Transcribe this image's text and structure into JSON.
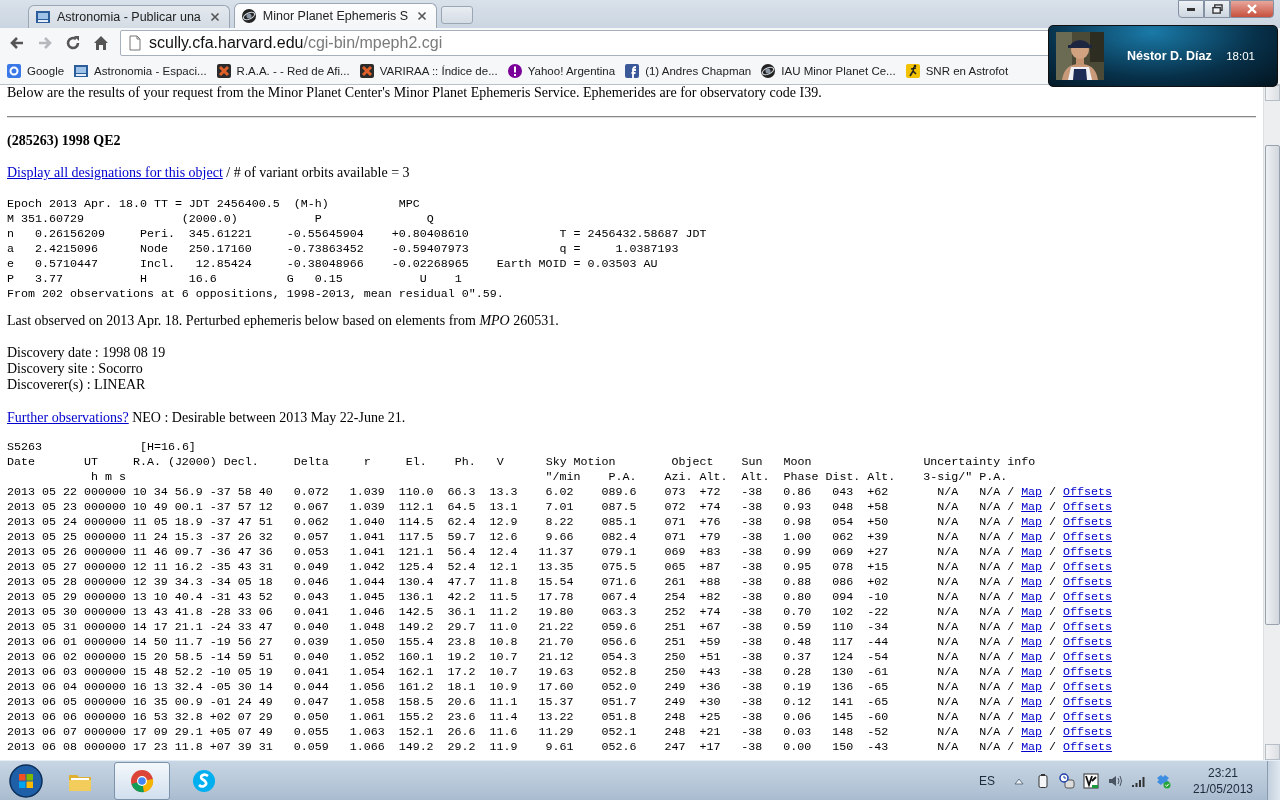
{
  "browser": {
    "tabs": [
      {
        "title": "Astronomia - Publicar una",
        "selected": false
      },
      {
        "title": "Minor Planet Ephemeris S",
        "selected": true
      }
    ],
    "address": {
      "host": "scully.cfa.harvard.edu",
      "path": "/cgi-bin/mpeph2.cgi"
    },
    "bookmarks": [
      {
        "label": "Google"
      },
      {
        "label": "Astronomia - Espaci..."
      },
      {
        "label": "R.A.A. - - Red de Afi..."
      },
      {
        "label": "VARIRAA :: Índice de..."
      },
      {
        "label": "Yahoo! Argentina"
      },
      {
        "label": "(1) Andres Chapman"
      },
      {
        "label": "IAU Minor Planet Ce..."
      },
      {
        "label": "SNR en Astrofot"
      }
    ]
  },
  "page": {
    "intro": "Below are the results of your request from the Minor Planet Center's Minor Planet Ephemeris Service. Ephemerides are for observatory code I39.",
    "object_title": "(285263) 1998 QE2",
    "designations": {
      "link": "Display all designations for this object",
      "text": "/ # of variant orbits available = 3"
    },
    "elements": [
      "Epoch 2013 Apr. 18.0 TT = JDT 2456400.5  (M-h)          MPC",
      "M 351.60729              (2000.0)           P               Q",
      "n   0.26156209     Peri.  345.61221     -0.55645904    +0.80408610             T = 2456432.58687 JDT",
      "a   2.4215096      Node   250.17160     -0.73863452    -0.59407973             q =     1.0387193",
      "e   0.5710447      Incl.   12.85424     -0.38048966    -0.02268965    Earth MOID = 0.03503 AU",
      "P   3.77           H      16.6          G   0.15           U    1",
      "From 202 observations at 6 oppositions, 1998-2013, mean residual 0\".59."
    ],
    "last_observed": "Last observed on 2013 Apr. 18. Perturbed ephemeris below based on elements from *MPO* 260531.",
    "discovery": [
      "Discovery date : 1998 08 19",
      "Discovery site : Socorro",
      "Discoverer(s) : LINEAR"
    ],
    "further": {
      "link": "Further observations?",
      "text": "NEO : Desirable between 2013 May 22-June 21."
    },
    "ephemeris": {
      "header_lines": [
        [
          "S5263",
          "[H=16.6]"
        ],
        [
          "Date",
          "UT",
          "R.A. (J2000) Decl.",
          "Delta",
          "r",
          "El.",
          "Ph.",
          "V",
          "Sky Motion",
          "Object",
          "Sun",
          "Moon",
          "Uncertainty info"
        ],
        [
          "h m s",
          "\"/min",
          "P.A.",
          "Azi.",
          "Alt.",
          "Alt.",
          "Phase",
          "Dist.",
          "Alt.",
          "3-sig/\"",
          "P.A."
        ]
      ],
      "rows": [
        {
          "cells": [
            "2013 05 22",
            "000000",
            "10 34 56.9",
            "-37 58 40",
            "0.072",
            "1.039",
            "110.0",
            "66.3",
            "13.3",
            "6.02",
            "089.6",
            "073",
            "+72",
            "-38",
            "0.86",
            "043",
            "+62",
            "N/A",
            "N/A"
          ],
          "separators": [
            "/",
            "/"
          ],
          "links": [
            "Map",
            "Offsets"
          ]
        },
        {
          "cells": [
            "2013 05 23",
            "000000",
            "10 49 00.1",
            "-37 57 12",
            "0.067",
            "1.039",
            "112.1",
            "64.5",
            "13.1",
            "7.01",
            "087.5",
            "072",
            "+74",
            "-38",
            "0.93",
            "048",
            "+58",
            "N/A",
            "N/A"
          ],
          "separators": [
            "/",
            "/"
          ],
          "links": [
            "Map",
            "Offsets"
          ]
        },
        {
          "cells": [
            "2013 05 24",
            "000000",
            "11 05 18.9",
            "-37 47 51",
            "0.062",
            "1.040",
            "114.5",
            "62.4",
            "12.9",
            "8.22",
            "085.1",
            "071",
            "+76",
            "-38",
            "0.98",
            "054",
            "+50",
            "N/A",
            "N/A"
          ],
          "separators": [
            "/",
            "/"
          ],
          "links": [
            "Map",
            "Offsets"
          ]
        },
        {
          "cells": [
            "2013 05 25",
            "000000",
            "11 24 15.3",
            "-37 26 32",
            "0.057",
            "1.041",
            "117.5",
            "59.7",
            "12.6",
            "9.66",
            "082.4",
            "071",
            "+79",
            "-38",
            "1.00",
            "062",
            "+39",
            "N/A",
            "N/A"
          ],
          "separators": [
            "/",
            "/"
          ],
          "links": [
            "Map",
            "Offsets"
          ]
        },
        {
          "cells": [
            "2013 05 26",
            "000000",
            "11 46 09.7",
            "-36 47 36",
            "0.053",
            "1.041",
            "121.1",
            "56.4",
            "12.4",
            "11.37",
            "079.1",
            "069",
            "+83",
            "-38",
            "0.99",
            "069",
            "+27",
            "N/A",
            "N/A"
          ],
          "separators": [
            "/",
            "/"
          ],
          "links": [
            "Map",
            "Offsets"
          ]
        },
        {
          "cells": [
            "2013 05 27",
            "000000",
            "12 11 16.2",
            "-35 43 31",
            "0.049",
            "1.042",
            "125.4",
            "52.4",
            "12.1",
            "13.35",
            "075.5",
            "065",
            "+87",
            "-38",
            "0.95",
            "078",
            "+15",
            "N/A",
            "N/A"
          ],
          "separators": [
            "/",
            "/"
          ],
          "links": [
            "Map",
            "Offsets"
          ]
        },
        {
          "cells": [
            "2013 05 28",
            "000000",
            "12 39 34.3",
            "-34 05 18",
            "0.046",
            "1.044",
            "130.4",
            "47.7",
            "11.8",
            "15.54",
            "071.6",
            "261",
            "+88",
            "-38",
            "0.88",
            "086",
            "+02",
            "N/A",
            "N/A"
          ],
          "separators": [
            "/",
            "/"
          ],
          "links": [
            "Map",
            "Offsets"
          ]
        },
        {
          "cells": [
            "2013 05 29",
            "000000",
            "13 10 40.4",
            "-31 43 52",
            "0.043",
            "1.045",
            "136.1",
            "42.2",
            "11.5",
            "17.78",
            "067.4",
            "254",
            "+82",
            "-38",
            "0.80",
            "094",
            "-10",
            "N/A",
            "N/A"
          ],
          "separators": [
            "/",
            "/"
          ],
          "links": [
            "Map",
            "Offsets"
          ]
        },
        {
          "cells": [
            "2013 05 30",
            "000000",
            "13 43 41.8",
            "-28 33 06",
            "0.041",
            "1.046",
            "142.5",
            "36.1",
            "11.2",
            "19.80",
            "063.3",
            "252",
            "+74",
            "-38",
            "0.70",
            "102",
            "-22",
            "N/A",
            "N/A"
          ],
          "separators": [
            "/",
            "/"
          ],
          "links": [
            "Map",
            "Offsets"
          ]
        },
        {
          "cells": [
            "2013 05 31",
            "000000",
            "14 17 21.1",
            "-24 33 47",
            "0.040",
            "1.048",
            "149.2",
            "29.7",
            "11.0",
            "21.22",
            "059.6",
            "251",
            "+67",
            "-38",
            "0.59",
            "110",
            "-34",
            "N/A",
            "N/A"
          ],
          "separators": [
            "/",
            "/"
          ],
          "links": [
            "Map",
            "Offsets"
          ]
        },
        {
          "cells": [
            "2013 06 01",
            "000000",
            "14 50 11.7",
            "-19 56 27",
            "0.039",
            "1.050",
            "155.4",
            "23.8",
            "10.8",
            "21.70",
            "056.6",
            "251",
            "+59",
            "-38",
            "0.48",
            "117",
            "-44",
            "N/A",
            "N/A"
          ],
          "separators": [
            "/",
            "/"
          ],
          "links": [
            "Map",
            "Offsets"
          ]
        },
        {
          "cells": [
            "2013 06 02",
            "000000",
            "15 20 58.5",
            "-14 59 51",
            "0.040",
            "1.052",
            "160.1",
            "19.2",
            "10.7",
            "21.12",
            "054.3",
            "250",
            "+51",
            "-38",
            "0.37",
            "124",
            "-54",
            "N/A",
            "N/A"
          ],
          "separators": [
            "/",
            "/"
          ],
          "links": [
            "Map",
            "Offsets"
          ]
        },
        {
          "cells": [
            "2013 06 03",
            "000000",
            "15 48 52.2",
            "-10 05 19",
            "0.041",
            "1.054",
            "162.1",
            "17.2",
            "10.7",
            "19.63",
            "052.8",
            "250",
            "+43",
            "-38",
            "0.28",
            "130",
            "-61",
            "N/A",
            "N/A"
          ],
          "separators": [
            "/",
            "/"
          ],
          "links": [
            "Map",
            "Offsets"
          ]
        },
        {
          "cells": [
            "2013 06 04",
            "000000",
            "16 13 32.4",
            "-05 30 14",
            "0.044",
            "1.056",
            "161.2",
            "18.1",
            "10.9",
            "17.60",
            "052.0",
            "249",
            "+36",
            "-38",
            "0.19",
            "136",
            "-65",
            "N/A",
            "N/A"
          ],
          "separators": [
            "/",
            "/"
          ],
          "links": [
            "Map",
            "Offsets"
          ]
        },
        {
          "cells": [
            "2013 06 05",
            "000000",
            "16 35 00.9",
            "-01 24 49",
            "0.047",
            "1.058",
            "158.5",
            "20.6",
            "11.1",
            "15.37",
            "051.7",
            "249",
            "+30",
            "-38",
            "0.12",
            "141",
            "-65",
            "N/A",
            "N/A"
          ],
          "separators": [
            "/",
            "/"
          ],
          "links": [
            "Map",
            "Offsets"
          ]
        },
        {
          "cells": [
            "2013 06 06",
            "000000",
            "16 53 32.8",
            "+02 07 29",
            "0.050",
            "1.061",
            "155.2",
            "23.6",
            "11.4",
            "13.22",
            "051.8",
            "248",
            "+25",
            "-38",
            "0.06",
            "145",
            "-60",
            "N/A",
            "N/A"
          ],
          "separators": [
            "/",
            "/"
          ],
          "links": [
            "Map",
            "Offsets"
          ]
        },
        {
          "cells": [
            "2013 06 07",
            "000000",
            "17 09 29.1",
            "+05 07 49",
            "0.055",
            "1.063",
            "152.1",
            "26.6",
            "11.6",
            "11.29",
            "052.1",
            "248",
            "+21",
            "-38",
            "0.03",
            "148",
            "-52",
            "N/A",
            "N/A"
          ],
          "separators": [
            "/",
            "/"
          ],
          "links": [
            "Map",
            "Offsets"
          ]
        },
        {
          "cells": [
            "2013 06 08",
            "000000",
            "17 23 11.8",
            "+07 39 31",
            "0.059",
            "1.066",
            "149.2",
            "29.2",
            "11.9",
            "9.61",
            "052.6",
            "247",
            "+17",
            "-38",
            "0.00",
            "150",
            "-43",
            "N/A",
            "N/A"
          ],
          "separators": [
            "/",
            "/"
          ],
          "links": [
            "Map",
            "Offsets"
          ]
        }
      ]
    }
  },
  "notification": {
    "name": "Néstor D. Díaz",
    "time": "18:01"
  },
  "taskbar": {
    "apps": [
      {
        "selected": false
      },
      {
        "selected": true
      },
      {
        "selected": false
      }
    ],
    "language": "ES",
    "time": "23:21",
    "date": "21/05/2013"
  }
}
